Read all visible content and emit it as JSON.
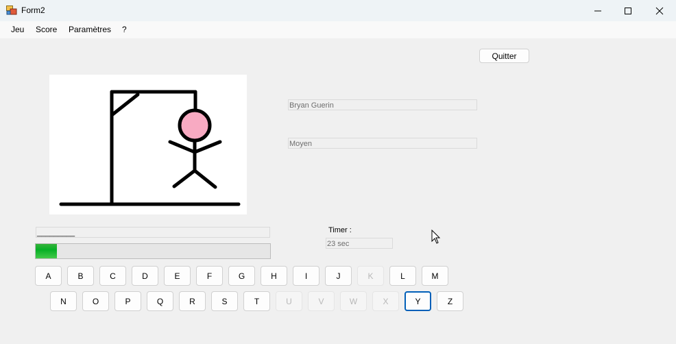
{
  "window": {
    "title": "Form2"
  },
  "menu": {
    "items": [
      "Jeu",
      "Score",
      "Paramètres",
      "?"
    ]
  },
  "buttons": {
    "quit": "Quitter"
  },
  "player": {
    "name": "Bryan Guerin",
    "level": "Moyen"
  },
  "word": {
    "mask": "_________"
  },
  "progress": {
    "fraction": 0.09
  },
  "timer": {
    "label": "Timer :",
    "value": "23 sec"
  },
  "keyboard": {
    "row1": [
      {
        "letter": "A",
        "state": "enabled"
      },
      {
        "letter": "B",
        "state": "enabled"
      },
      {
        "letter": "C",
        "state": "enabled"
      },
      {
        "letter": "D",
        "state": "enabled"
      },
      {
        "letter": "E",
        "state": "enabled"
      },
      {
        "letter": "F",
        "state": "enabled"
      },
      {
        "letter": "G",
        "state": "enabled"
      },
      {
        "letter": "H",
        "state": "enabled"
      },
      {
        "letter": "I",
        "state": "enabled"
      },
      {
        "letter": "J",
        "state": "enabled"
      },
      {
        "letter": "K",
        "state": "disabled"
      },
      {
        "letter": "L",
        "state": "enabled"
      },
      {
        "letter": "M",
        "state": "enabled"
      }
    ],
    "row2": [
      {
        "letter": "N",
        "state": "enabled"
      },
      {
        "letter": "O",
        "state": "enabled"
      },
      {
        "letter": "P",
        "state": "enabled"
      },
      {
        "letter": "Q",
        "state": "enabled"
      },
      {
        "letter": "R",
        "state": "enabled"
      },
      {
        "letter": "S",
        "state": "enabled"
      },
      {
        "letter": "T",
        "state": "enabled"
      },
      {
        "letter": "U",
        "state": "disabled"
      },
      {
        "letter": "V",
        "state": "disabled"
      },
      {
        "letter": "W",
        "state": "disabled"
      },
      {
        "letter": "X",
        "state": "disabled"
      },
      {
        "letter": "Y",
        "state": "focused"
      },
      {
        "letter": "Z",
        "state": "enabled"
      }
    ]
  },
  "colors": {
    "progress_fill": "#06b025",
    "head": "#f8aac2",
    "focus_border": "#005fb8"
  }
}
